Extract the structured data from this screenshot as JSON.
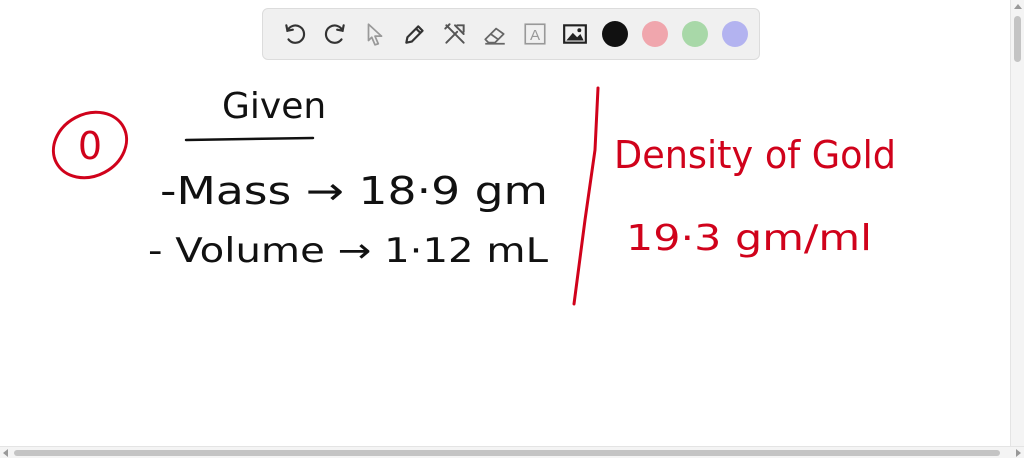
{
  "toolbar": {
    "tools": [
      {
        "name": "undo-icon"
      },
      {
        "name": "redo-icon"
      },
      {
        "name": "pointer-icon"
      },
      {
        "name": "pen-icon"
      },
      {
        "name": "tools-icon"
      },
      {
        "name": "eraser-icon"
      },
      {
        "name": "text-icon",
        "glyph": "A"
      },
      {
        "name": "image-icon"
      }
    ],
    "colors": [
      "#111111",
      "#f0a6ad",
      "#a8d8a8",
      "#b3b3f0"
    ]
  },
  "board": {
    "problem_number": "0",
    "given_heading": "Given",
    "mass_line": "-Mass → 18·9 gm",
    "volume_line": "- Volume → 1·12 mL",
    "density_heading": "Density of Gold",
    "density_value": "19·3 gm/ml",
    "ink_black": "#111111",
    "ink_red": "#d0021b"
  }
}
